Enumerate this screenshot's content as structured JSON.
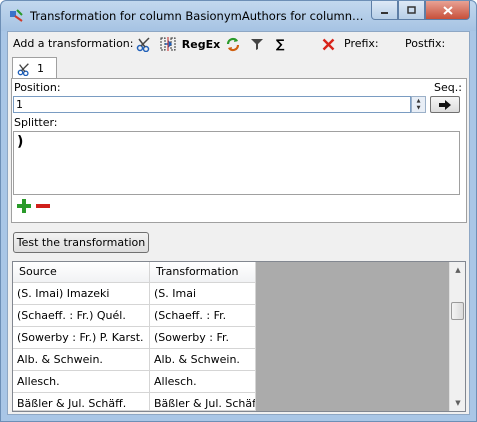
{
  "window": {
    "title": "Transformation for column BasionymAuthors for column Basi..."
  },
  "toolbar": {
    "add_label": "Add a transformation:",
    "regex_label": "RegEx",
    "sum_label": "∑",
    "prefix_label": "Prefix:",
    "postfix_label": "Postfix:"
  },
  "tabs": [
    {
      "label": "1"
    }
  ],
  "form": {
    "position_label": "Position:",
    "position_value": "1",
    "seq_label": "Seq.:",
    "splitter_label": "Splitter:",
    "splitter_value": ")"
  },
  "actions": {
    "test_label": "Test the transformation"
  },
  "grid": {
    "headers": [
      "Source",
      "Transformation"
    ],
    "rows": [
      [
        "(S. Imai) Imazeki",
        "(S. Imai"
      ],
      [
        "(Schaeff. : Fr.) Quél.",
        "(Schaeff. : Fr."
      ],
      [
        "(Sowerby : Fr.) P. Karst.",
        "(Sowerby : Fr."
      ],
      [
        "Alb. & Schwein.",
        "Alb. & Schwein."
      ],
      [
        "Allesch.",
        "Allesch."
      ],
      [
        "Bäßler & Jul. Schäff.",
        "Bäßler & Jul. Schäff."
      ]
    ]
  },
  "icons": {
    "app": "transform-app-icon",
    "scissors": "scissors-icon",
    "column_split": "column-split-icon",
    "replace": "replace-icon",
    "filter": "filter-icon",
    "sum": "sum-icon",
    "clear": "red-x-icon",
    "arrow": "arrow-right-icon",
    "add": "green-plus-icon",
    "remove": "red-minus-icon"
  },
  "colors": {
    "window_frame": "#a9c6e6",
    "client_bg": "#f0f0f0",
    "add_green": "#2a9a2a",
    "remove_red": "#d0201a"
  }
}
